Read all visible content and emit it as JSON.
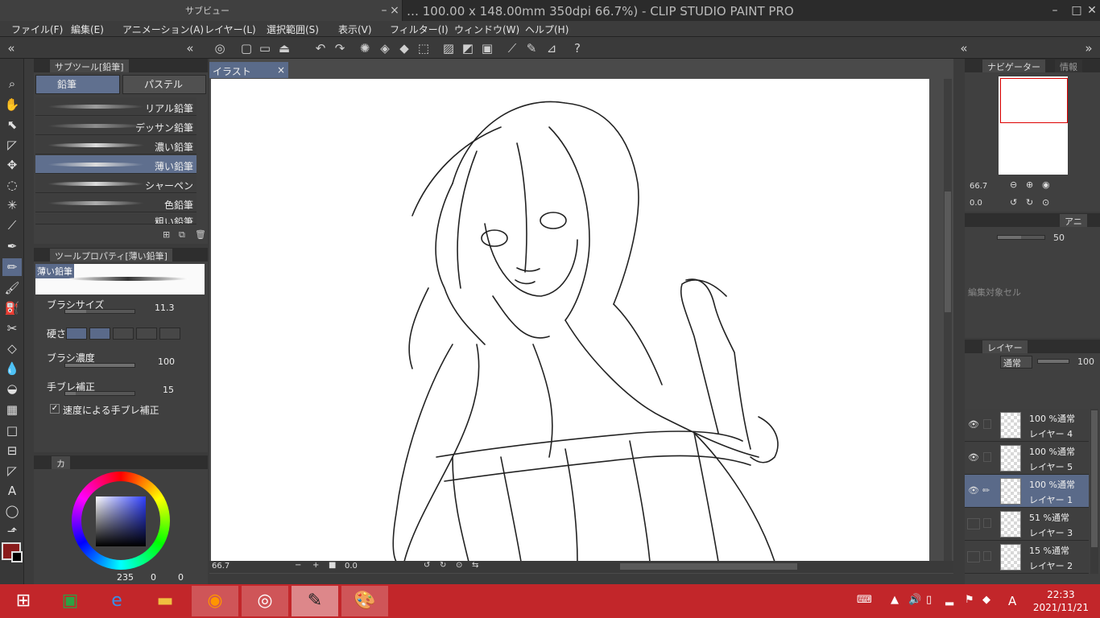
{
  "app": {
    "title": "… 100.00 x 148.00mm 350dpi 66.7%)  - CLIP STUDIO PAINT PRO",
    "subview_title": "サブビュー"
  },
  "menu": [
    "ファイル(F)",
    "編集(E)",
    "アニメーション(A)",
    "レイヤー(L)",
    "選択範囲(S)",
    "表示(V)",
    "フィルター(I)",
    "ウィンドウ(W)",
    "ヘルプ(H)"
  ],
  "subtool": {
    "tab_label": "サブツール[鉛筆]",
    "categories": [
      "鉛筆",
      "パステル"
    ],
    "brushes": [
      "リアル鉛筆",
      "デッサン鉛筆",
      "濃い鉛筆",
      "薄い鉛筆",
      "シャーペン",
      "色鉛筆",
      "粗い鉛筆"
    ],
    "selected": "薄い鉛筆"
  },
  "toolprop": {
    "tab_label": "ツールプロパティ[薄い鉛筆]",
    "preview_label": "薄い鉛筆",
    "brush_size_label": "ブラシサイズ",
    "brush_size_value": "11.3",
    "hardness_label": "硬さ",
    "density_label": "ブラシ濃度",
    "density_value": "100",
    "stabilization_label": "手ブレ補正",
    "stabilization_value": "15",
    "speed_checkbox_label": "速度による手ブレ補正"
  },
  "colorpanel": {
    "tab_label": "カ",
    "values": [
      "235",
      "0",
      "0"
    ],
    "main_color": "#8a1c1c",
    "sub_color": "#000000"
  },
  "canvas": {
    "tab_label": "イラスト",
    "zoom": "66.7",
    "angle": "0.0"
  },
  "navigator": {
    "tab_label": "ナビゲーター",
    "info_tab": "情報",
    "zoom": "66.7",
    "rotation": "0.0"
  },
  "layerprop": {
    "tab_label": "アニ",
    "opacity": "50",
    "edit_target": "編集対象セル"
  },
  "layers": {
    "tab_label": "レイヤー",
    "blend_mode": "通常",
    "opacity": "100",
    "items": [
      {
        "mode": "100 %通常",
        "name": "レイヤー 4",
        "visible": true,
        "selected": false
      },
      {
        "mode": "100 %通常",
        "name": "レイヤー 5",
        "visible": true,
        "selected": false
      },
      {
        "mode": "100 %通常",
        "name": "レイヤー 1",
        "visible": true,
        "selected": true
      },
      {
        "mode": "51 %通常",
        "name": "レイヤー 3",
        "visible": false,
        "selected": false
      },
      {
        "mode": "15 %通常",
        "name": "レイヤー 2",
        "visible": false,
        "selected": false
      }
    ]
  },
  "taskbar": {
    "time": "22:33",
    "date": "2021/11/21",
    "ime": "A"
  }
}
